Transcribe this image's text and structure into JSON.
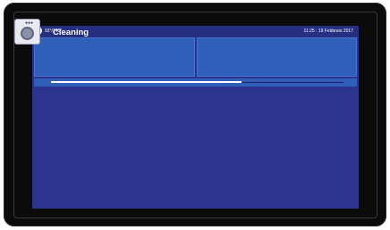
{
  "status": {
    "position": "92°/145°",
    "datetime": "11:25 : 19 Febbraio 2017"
  },
  "tiles": [
    {
      "label": "Cleaning",
      "icon": "washing-machine-icon"
    },
    {
      "label": ""
    }
  ],
  "progress": {
    "fraction": 0.65
  },
  "colors": {
    "screen_bg": "#2b3590",
    "tile_bg": "#2f5fb8",
    "progress_fill": "#ffffff"
  }
}
